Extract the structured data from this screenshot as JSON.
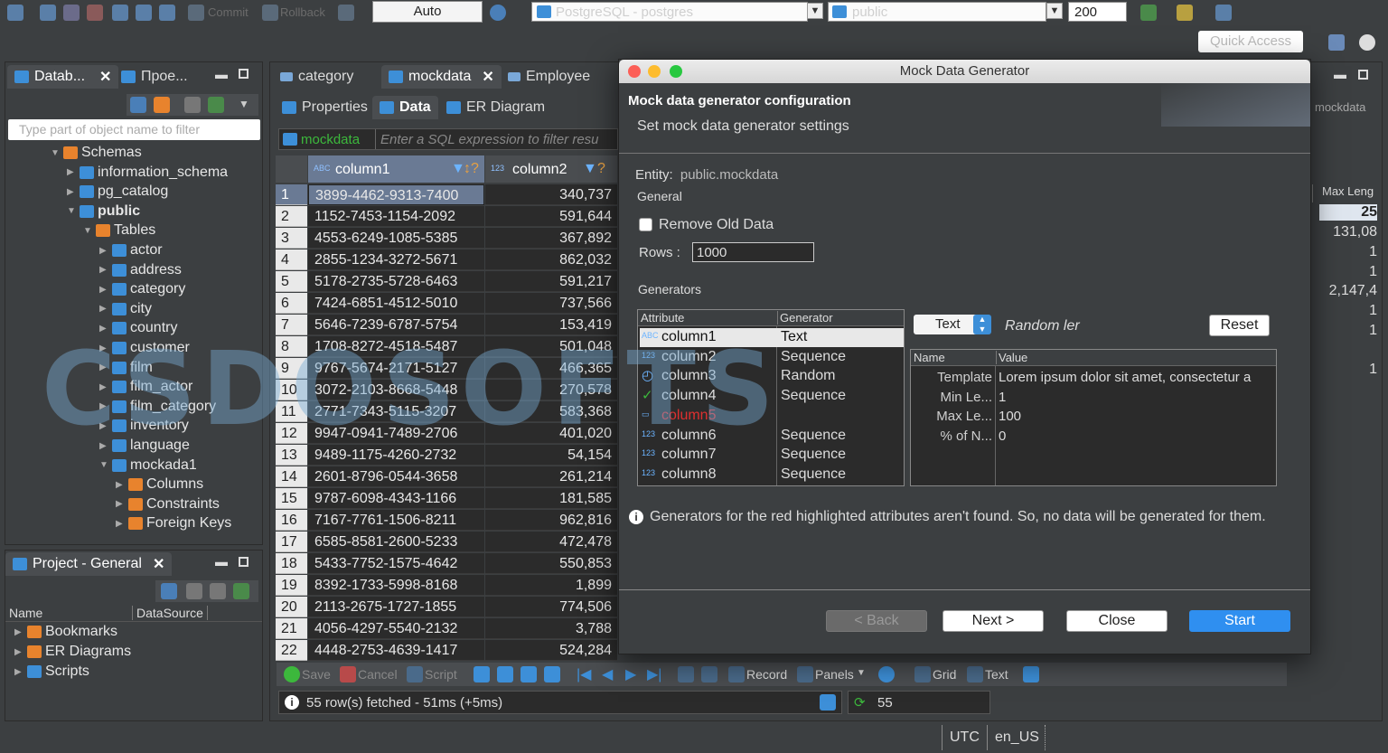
{
  "toolbar": {
    "commit_label": "Commit",
    "rollback_label": "Rollback",
    "transaction_mode": "Auto",
    "datasource": "PostgreSQL - postgres",
    "schema": "public",
    "result_limit": "200",
    "quick_access": "Quick Access"
  },
  "left_panel": {
    "tabs": [
      "Datab...",
      "Прое..."
    ],
    "filter_placeholder": "Type part of object name to filter",
    "tree": [
      {
        "label": "Schemas",
        "depth": 0
      },
      {
        "label": "information_schema",
        "depth": 1
      },
      {
        "label": "pg_catalog",
        "depth": 1
      },
      {
        "label": "public",
        "depth": 1
      },
      {
        "label": "Tables",
        "depth": 2
      },
      {
        "label": "actor",
        "depth": 3
      },
      {
        "label": "address",
        "depth": 3
      },
      {
        "label": "category",
        "depth": 3
      },
      {
        "label": "city",
        "depth": 3
      },
      {
        "label": "country",
        "depth": 3
      },
      {
        "label": "customer",
        "depth": 3
      },
      {
        "label": "film",
        "depth": 3
      },
      {
        "label": "film_actor",
        "depth": 3
      },
      {
        "label": "film_category",
        "depth": 3
      },
      {
        "label": "inventory",
        "depth": 3
      },
      {
        "label": "language",
        "depth": 3
      },
      {
        "label": "mockada1",
        "depth": 3
      },
      {
        "label": "Columns",
        "depth": 4
      },
      {
        "label": "Constraints",
        "depth": 4
      },
      {
        "label": "Foreign Keys",
        "depth": 4
      }
    ]
  },
  "project_panel": {
    "title": "Project - General",
    "col_name": "Name",
    "col_datasource": "DataSource",
    "items": [
      "Bookmarks",
      "ER Diagrams",
      "Scripts"
    ]
  },
  "editor": {
    "tabs": [
      "category",
      "mockdata",
      "Employee"
    ],
    "subtabs": [
      "Properties",
      "Data",
      "ER Diagram"
    ],
    "filter_table": "mockdata",
    "filter_placeholder": "Enter a SQL expression to filter resu",
    "columns": [
      "column1",
      "column2"
    ],
    "rows": [
      [
        "1",
        "3899-4462-9313-7400",
        "340,737"
      ],
      [
        "2",
        "1152-7453-1154-2092",
        "591,644"
      ],
      [
        "3",
        "4553-6249-1085-5385",
        "367,892"
      ],
      [
        "4",
        "2855-1234-3272-5671",
        "862,032"
      ],
      [
        "5",
        "5178-2735-5728-6463",
        "591,217"
      ],
      [
        "6",
        "7424-6851-4512-5010",
        "737,566"
      ],
      [
        "7",
        "5646-7239-6787-5754",
        "153,419"
      ],
      [
        "8",
        "1708-8272-4518-5487",
        "501,048"
      ],
      [
        "9",
        "9767-5674-2171-5127",
        "466,365"
      ],
      [
        "10",
        "3072-2103-8668-5448",
        "270,578"
      ],
      [
        "11",
        "2771-7343-5115-3207",
        "583,368"
      ],
      [
        "12",
        "9947-0941-7489-2706",
        "401,020"
      ],
      [
        "13",
        "9489-1175-4260-2732",
        "54,154"
      ],
      [
        "14",
        "2601-8796-0544-3658",
        "261,214"
      ],
      [
        "15",
        "9787-6098-4343-1166",
        "181,585"
      ],
      [
        "16",
        "7167-7761-1506-8211",
        "962,816"
      ],
      [
        "17",
        "6585-8581-2600-5233",
        "472,478"
      ],
      [
        "18",
        "5433-7752-1575-4642",
        "550,853"
      ],
      [
        "19",
        "8392-1733-5998-8168",
        "1,899"
      ],
      [
        "20",
        "2113-2675-1727-1855",
        "774,506"
      ],
      [
        "21",
        "4056-4297-5540-2132",
        "3,788"
      ],
      [
        "22",
        "4448-2753-4639-1417",
        "524,284"
      ]
    ],
    "bottom_toolbar": [
      "Save",
      "Cancel",
      "Script",
      "Record",
      "Panels",
      "Grid",
      "Text"
    ],
    "status_text": "55 row(s) fetched - 51ms (+5ms)",
    "row_count": "55"
  },
  "right_partial": {
    "header_fragment": "mockdata",
    "col_header": "Max Leng",
    "values": [
      "25",
      "131,08",
      "1",
      "1",
      "2,147,4",
      "1",
      "1",
      "1"
    ]
  },
  "dialog": {
    "title": "Mock Data Generator",
    "heading": "Mock data generator configuration",
    "subheading": "Set mock data generator settings",
    "entity_label": "Entity:",
    "entity_value": "public.mockdata",
    "general_label": "General",
    "remove_old_label": "Remove Old Data",
    "rows_label": "Rows :",
    "rows_value": "1000",
    "generators_label": "Generators",
    "attr_header": "Attribute",
    "gen_header": "Generator",
    "attributes": [
      {
        "name": "column1",
        "generator": "Text",
        "missing": false
      },
      {
        "name": "column2",
        "generator": "Sequence",
        "missing": false
      },
      {
        "name": "column3",
        "generator": "Random",
        "missing": false
      },
      {
        "name": "column4",
        "generator": "Sequence",
        "missing": false
      },
      {
        "name": "column5",
        "generator": "",
        "missing": true
      },
      {
        "name": "column6",
        "generator": "Sequence",
        "missing": false
      },
      {
        "name": "column7",
        "generator": "Sequence",
        "missing": false
      },
      {
        "name": "column8",
        "generator": "Sequence",
        "missing": false
      }
    ],
    "generator_select": "Text",
    "generator_desc": "Random ler",
    "reset_label": "Reset",
    "props_name_header": "Name",
    "props_value_header": "Value",
    "props": [
      {
        "name": "Template",
        "value": "Lorem ipsum dolor sit amet, consectetur a"
      },
      {
        "name": "Min Le...",
        "value": "1"
      },
      {
        "name": "Max Le...",
        "value": "100"
      },
      {
        "name": "% of N...",
        "value": "0"
      }
    ],
    "info_text": "Generators for the red highlighted attributes aren't found. So, no data will be generated for them.",
    "back_label": "< Back",
    "next_label": "Next >",
    "close_label": "Close",
    "start_label": "Start"
  },
  "statusbar": {
    "timezone": "UTC",
    "locale": "en_US"
  },
  "watermark": "CSDOSOFTS",
  "colors": {
    "accent_blue": "#3d8fd8",
    "folder_orange": "#e8832d",
    "missing_red": "#e03030",
    "start_button": "#2f8ff0"
  }
}
